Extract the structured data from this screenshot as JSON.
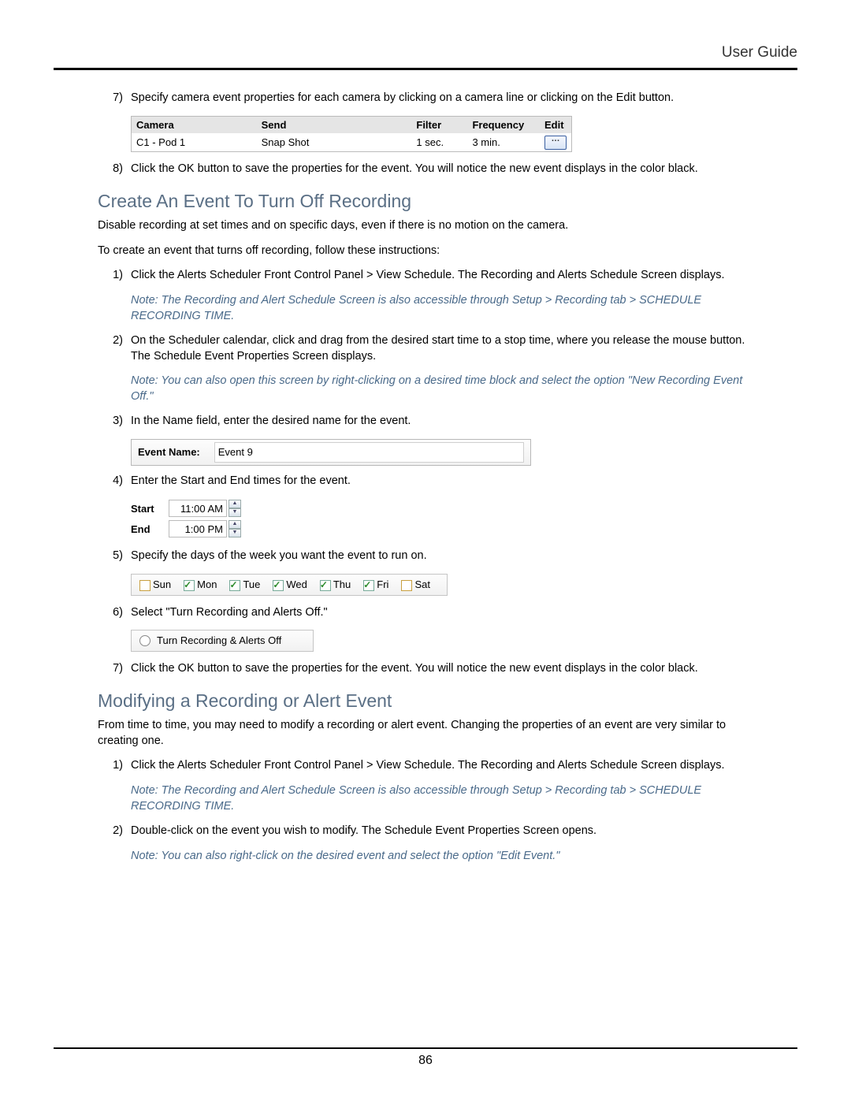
{
  "header": {
    "title": "User Guide"
  },
  "page_number": "86",
  "top_steps": {
    "s7": {
      "num": "7)",
      "text": "Specify camera event properties for each camera by clicking on a camera line or clicking on the Edit button."
    },
    "s8": {
      "num": "8)",
      "text": "Click the OK button to save the properties for the event. You will notice the new event displays in the color black."
    }
  },
  "cam_table": {
    "headers": {
      "camera": "Camera",
      "send": "Send",
      "filter": "Filter",
      "frequency": "Frequency",
      "edit": "Edit"
    },
    "row": {
      "camera": "C1 - Pod 1",
      "send": "Snap Shot",
      "filter": "1 sec.",
      "frequency": "3 min."
    }
  },
  "section1": {
    "heading": "Create An Event To Turn Off Recording",
    "p1": "Disable recording at set times and on specific days, even if there is no motion on the camera.",
    "p2": "To create an event that turns off recording, follow these instructions:",
    "steps": {
      "s1": {
        "num": "1)",
        "text": "Click the Alerts Scheduler Front Control Panel > View Schedule.  The Recording and Alerts Schedule Screen displays."
      },
      "note1": "Note: The Recording and Alert Schedule Screen is also accessible through Setup > Recording tab > SCHEDULE RECORDING TIME.",
      "s2": {
        "num": "2)",
        "text": "On the Scheduler calendar, click and drag from the desired start time to a stop time, where you release the mouse button.  The Schedule Event Properties Screen displays."
      },
      "note2": "Note: You can also open this screen by right-clicking on a desired time block and select the option \"New Recording Event Off.\"",
      "s3": {
        "num": "3)",
        "text": "In the Name field, enter the desired name for the event."
      },
      "s4": {
        "num": "4)",
        "text": "Enter the Start and End times for the event."
      },
      "s5": {
        "num": "5)",
        "text": "Specify the days of the week you want the event to run on."
      },
      "s6": {
        "num": "6)",
        "text": "Select \"Turn Recording and Alerts Off.\""
      },
      "s7": {
        "num": "7)",
        "text": "Click the OK button to save the properties for the event. You will notice the new event displays in the color black."
      }
    }
  },
  "event_name": {
    "label": "Event Name:",
    "value": "Event 9"
  },
  "times": {
    "start_label": "Start",
    "start_value": "11:00 AM",
    "end_label": "End",
    "end_value": "1:00 PM"
  },
  "days": {
    "sun": "Sun",
    "mon": "Mon",
    "tue": "Tue",
    "wed": "Wed",
    "thu": "Thu",
    "fri": "Fri",
    "sat": "Sat"
  },
  "radio": {
    "label": "Turn Recording & Alerts Off"
  },
  "section2": {
    "heading": "Modifying a Recording or Alert Event",
    "p1": "From time to time, you may need to modify a recording or alert event. Changing the properties of an event  are very similar to creating one.",
    "steps": {
      "s1": {
        "num": "1)",
        "text": "Click the Alerts Scheduler Front Control Panel > View Schedule.  The Recording and Alerts Schedule Screen displays."
      },
      "note1": "Note: The Recording and Alert Schedule Screen is also accessible through Setup > Recording tab > SCHEDULE RECORDING TIME.",
      "s2": {
        "num": "2)",
        "text": "Double-click on the event you wish to modify.  The Schedule Event Properties Screen opens."
      },
      "note2": "Note: You can also right-click on the desired event and select the option \"Edit Event.\""
    }
  }
}
